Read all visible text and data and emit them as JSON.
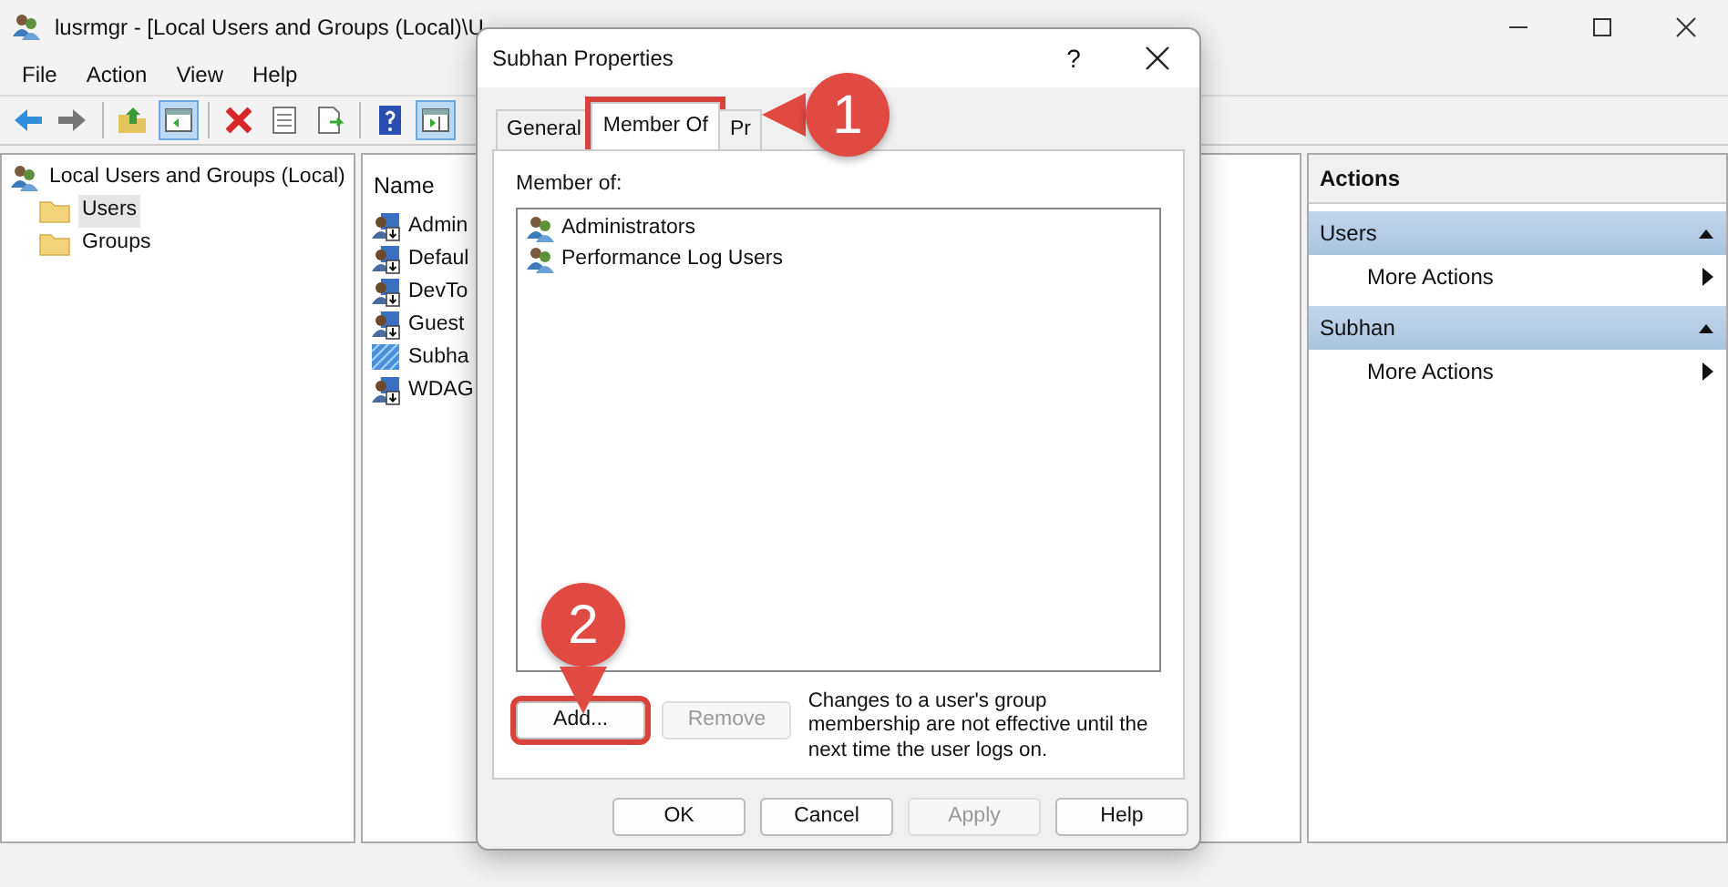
{
  "window": {
    "title": "lusrmgr - [Local Users and Groups (Local)\\U"
  },
  "menu": [
    "File",
    "Action",
    "View",
    "Help"
  ],
  "toolbar": [
    {
      "kind": "back",
      "on": false
    },
    {
      "kind": "forward",
      "on": false
    },
    {
      "kind": "separator"
    },
    {
      "kind": "up",
      "on": false
    },
    {
      "kind": "tree-pane",
      "on": true
    },
    {
      "kind": "separator"
    },
    {
      "kind": "delete",
      "on": false
    },
    {
      "kind": "properties",
      "on": false
    },
    {
      "kind": "export",
      "on": false
    },
    {
      "kind": "separator"
    },
    {
      "kind": "help",
      "on": false
    },
    {
      "kind": "action-pane",
      "on": true
    }
  ],
  "tree": {
    "label": "Local Users and Groups (Local)",
    "children": [
      {
        "label": "Users",
        "selected": true
      },
      {
        "label": "Groups",
        "selected": false
      }
    ]
  },
  "list": {
    "columns": [
      "Name"
    ],
    "rows": [
      {
        "name": "Admin",
        "kind": "user"
      },
      {
        "name": "Defaul",
        "kind": "user"
      },
      {
        "name": "DevTo",
        "kind": "user"
      },
      {
        "name": "Guest",
        "kind": "user"
      },
      {
        "name": "Subha",
        "kind": "pattern"
      },
      {
        "name": "WDAG",
        "kind": "user"
      }
    ]
  },
  "actions": {
    "title": "Actions",
    "sections": [
      {
        "title": "Users",
        "expanded": true,
        "items": [
          "More Actions"
        ]
      },
      {
        "title": "Subhan",
        "expanded": true,
        "items": [
          "More Actions"
        ]
      }
    ]
  },
  "dialog": {
    "title": "Subhan Properties",
    "help": "?",
    "tabs": [
      {
        "label": "General",
        "selected": false,
        "highlighted": false
      },
      {
        "label": "Member Of",
        "selected": true,
        "highlighted": true
      },
      {
        "label": "Pr",
        "selected": false,
        "highlighted": false
      }
    ],
    "member_label": "Member of:",
    "members": [
      "Administrators",
      "Performance Log Users"
    ],
    "buttons": [
      {
        "label": "Add...",
        "disabled": false,
        "highlighted": true
      },
      {
        "label": "Remove",
        "disabled": true,
        "highlighted": false
      }
    ],
    "note": "Changes to a user's group membership are not effective until the next time the user logs on.",
    "footer": [
      {
        "label": "OK",
        "disabled": false
      },
      {
        "label": "Cancel",
        "disabled": false
      },
      {
        "label": "Apply",
        "disabled": true
      },
      {
        "label": "Help",
        "disabled": false
      }
    ]
  },
  "annotations": [
    {
      "number": "1",
      "kind": "left"
    },
    {
      "number": "2",
      "kind": "down"
    }
  ]
}
